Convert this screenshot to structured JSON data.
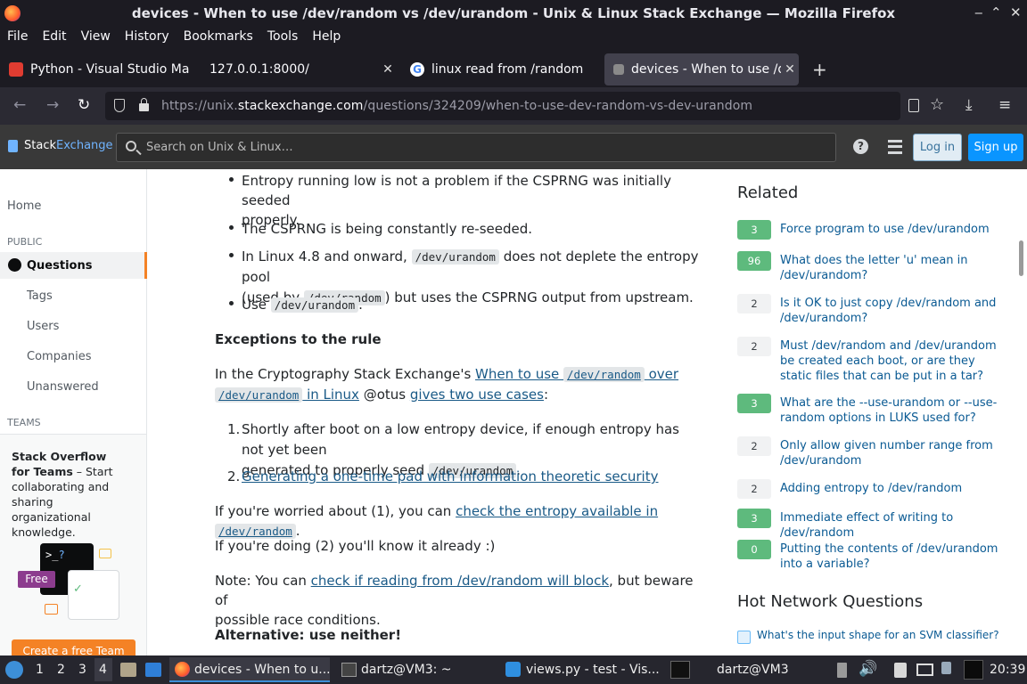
{
  "window": {
    "title": "devices - When to use /dev/random vs /dev/urandom - Unix & Linux Stack Exchange — Mozilla Firefox"
  },
  "menu": [
    "File",
    "Edit",
    "View",
    "History",
    "Bookmarks",
    "Tools",
    "Help"
  ],
  "tabs": [
    {
      "label": "Python - Visual Studio Ma",
      "favicon_color": "#e03c31",
      "active": false
    },
    {
      "label": "127.0.0.1:8000/",
      "favicon_color": "",
      "active": false
    },
    {
      "label": "linux read from /random",
      "favicon_color": "#4285f4",
      "active": false
    },
    {
      "label": "devices - When to use /de",
      "favicon_color": "#888888",
      "active": true
    }
  ],
  "nav": {
    "url_prefix": "https://unix.",
    "url_domain": "stackexchange.com",
    "url_path": "/questions/324209/when-to-use-dev-random-vs-dev-urandom"
  },
  "se_header": {
    "logo_a": "Stack",
    "logo_b": "Exchange",
    "search_placeholder": "Search on Unix & Linux…",
    "login": "Log in",
    "signup": "Sign up"
  },
  "leftnav": {
    "home": "Home",
    "public": "PUBLIC",
    "questions": "Questions",
    "tags": "Tags",
    "users": "Users",
    "companies": "Companies",
    "unanswered": "Unanswered",
    "teams": "TEAMS",
    "teams_title": "Stack Overflow for Teams",
    "teams_desc": " – Start collaborating and sharing organizational knowledge.",
    "free_badge": "Free",
    "cta": "Create a free Team"
  },
  "answer": {
    "b1_line1": "Entropy running low is not a problem if the CSPRNG was initially seeded",
    "b1_line2": "properly.",
    "b2": "The CSPRNG is being constantly re-seeded.",
    "b3_pre": "In Linux 4.8 and onward, ",
    "b3_code1": "/dev/urandom",
    "b3_mid": " does not deplete the entropy pool",
    "b3_pre2": "(used by ",
    "b3_code2": "/dev/random",
    "b3_post": ") but uses the CSPRNG output from upstream.",
    "b4_pre": "Use ",
    "b4_code": "/dev/urandom",
    "b4_post": ".",
    "h_exceptions": "Exceptions to the rule",
    "p1_pre": "In the Cryptography Stack Exchange's ",
    "p1_link1a": "When to use ",
    "p1_code1": "/dev/random",
    "p1_link1b": " over",
    "p1_code2": "/dev/urandom",
    "p1_link1c": " in Linux",
    "p1_mid": " @otus ",
    "p1_link2": "gives two use cases",
    "p1_post": ":",
    "o1_line1": "Shortly after boot on a low entropy device, if enough entropy has not yet been",
    "o1_line2_pre": "generated to properly seed ",
    "o1_code": "/dev/urandom",
    "o1_line2_post": ".",
    "o2_link": "Generating a one-time pad with information theoretic security",
    "p2_pre": "If you're worried about (1), you can ",
    "p2_link": "check the entropy available in ",
    "p2_code": "/dev/random",
    "p2_post": ".",
    "p3": "If you're doing (2) you'll know it already :)",
    "p4_pre": "Note: You can ",
    "p4_link": "check if reading from /dev/random will block",
    "p4_post": ", but beware of",
    "p4_line2": "possible race conditions.",
    "h_alt": "Alternative: use neither!"
  },
  "related": {
    "title": "Related",
    "items": [
      {
        "score": "3",
        "accepted": true,
        "text": "Force program to use /dev/urandom"
      },
      {
        "score": "96",
        "accepted": true,
        "text": "What does the letter 'u' mean in /dev/urandom?"
      },
      {
        "score": "2",
        "accepted": false,
        "text": "Is it OK to just copy /dev/random and /dev/urandom?"
      },
      {
        "score": "2",
        "accepted": false,
        "text": "Must /dev/random and /dev/urandom be created each boot, or are they static files that can be put in a tar?"
      },
      {
        "score": "3",
        "accepted": true,
        "text": "What are the --use-urandom or --use-random options in LUKS used for?"
      },
      {
        "score": "2",
        "accepted": false,
        "text": "Only allow given number range from /dev/urandom"
      },
      {
        "score": "2",
        "accepted": false,
        "text": "Adding entropy to /dev/random"
      },
      {
        "score": "3",
        "accepted": true,
        "text": "Immediate effect of writing to /dev/random"
      },
      {
        "score": "0",
        "accepted": true,
        "text": "Putting the contents of /dev/urandom into a variable?"
      }
    ],
    "hot_title": "Hot Network Questions",
    "hot_first": "What's the input shape for an SVM classifier?"
  },
  "taskbar": {
    "workspaces": [
      "1",
      "2",
      "3",
      "4"
    ],
    "items": [
      "devices - When to u...",
      "dartz@VM3: ~",
      "views.py - test - Vis...",
      "dartz@VM3"
    ],
    "clock": "20:39"
  }
}
